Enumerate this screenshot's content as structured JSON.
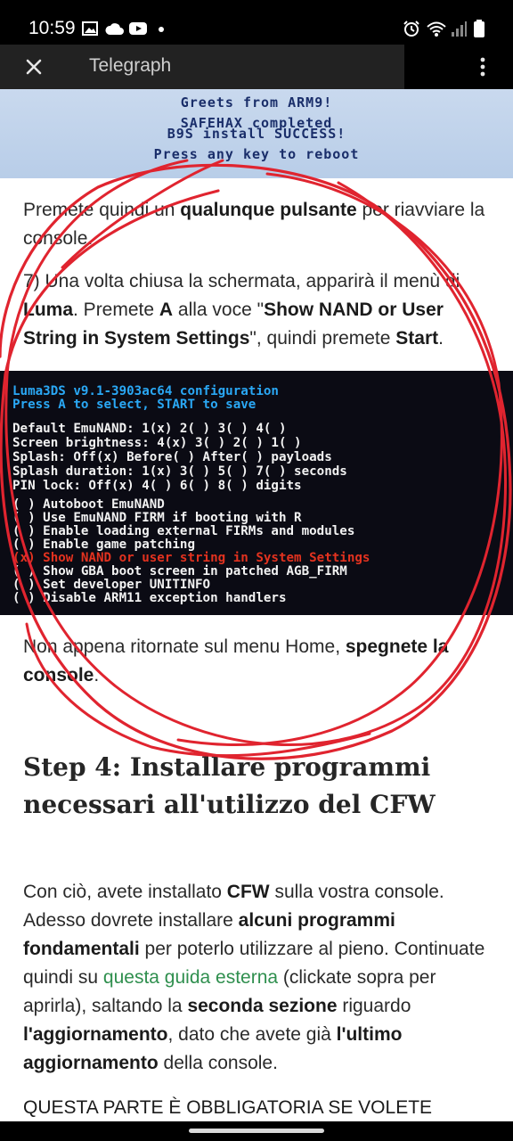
{
  "status_bar": {
    "time": "10:59",
    "left_icons": [
      "image-icon",
      "cloud-icon",
      "youtube-icon",
      "dot-icon"
    ],
    "right_icons": [
      "alarm-icon",
      "wifi-icon",
      "signal-icon",
      "battery-icon"
    ]
  },
  "app_bar": {
    "title": "Telegraph",
    "close_icon": "close-icon",
    "menu_icon": "more-vert-icon"
  },
  "top_screen": {
    "lines": [
      "Greets from ARM9!",
      "SAFEHAX completed",
      "B9S install SUCCESS!",
      "Press any key to reboot"
    ]
  },
  "paragraph1": {
    "a": "Premete quindi un ",
    "b": "qualunque pulsante",
    "c": " per riavviare la console."
  },
  "paragraph2": {
    "a": "7) Una volta chiusa la schermata, apparirà il menù di ",
    "b": "Luma",
    "c": ". Premete ",
    "d": "A",
    "e": " alla voce \"",
    "f": "Show NAND or User String in System Settings",
    "g": "\", quindi premete ",
    "h": "Start",
    "i": "."
  },
  "luma_screen": {
    "header": [
      "Luma3DS v9.1-3903ac64 configuration",
      "Press A to select, START to save"
    ],
    "settings": [
      "Default EmuNAND: 1(x) 2( ) 3( ) 4( )",
      "Screen brightness: 4(x) 3( ) 2( ) 1( )",
      "Splash: Off(x) Before( ) After( ) payloads",
      "Splash duration: 1(x) 3( ) 5( ) 7( ) seconds",
      "PIN lock: Off(x) 4( ) 6( ) 8( ) digits"
    ],
    "options": [
      "( ) Autoboot EmuNAND",
      "( ) Use EmuNAND FIRM if booting with R",
      "( ) Enable loading external FIRMs and modules",
      "( ) Enable game patching"
    ],
    "selected_option": "(x) Show NAND or user string in System Settings",
    "options_after": [
      "( ) Show GBA boot screen in patched AGB_FIRM",
      "( ) Set developer UNITINFO",
      "( ) Disable ARM11 exception handlers"
    ]
  },
  "paragraph3": {
    "a": "Non appena ritornate sul menu Home, ",
    "b": "spegnete la console",
    "c": "."
  },
  "heading": "Step 4: Installare programmi necessari all'utilizzo del CFW",
  "paragraph4": {
    "a": "Con ciò, avete installato ",
    "b": "CFW",
    "c": " sulla vostra console. Adesso dovrete installare ",
    "d": "alcuni programmi fondamentali",
    "e": " per poterlo utilizzare al pieno. Continuate quindi su ",
    "link": "questa guida esterna",
    "f": " (clickate sopra per aprirla), saltando la ",
    "g": "seconda sezione",
    "h": " riguardo ",
    "i": "l'aggiornamento",
    "j": ", dato che avete già ",
    "k": "l'ultimo aggiornamento",
    "l": " della console."
  },
  "paragraph5": "QUESTA PARTE È OBBLIGATORIA SE VOLETE",
  "colors": {
    "link": "#2f8f4e",
    "scribble": "#e0242f",
    "luma_blue": "#2aa8f5",
    "luma_red": "#e3321f"
  }
}
